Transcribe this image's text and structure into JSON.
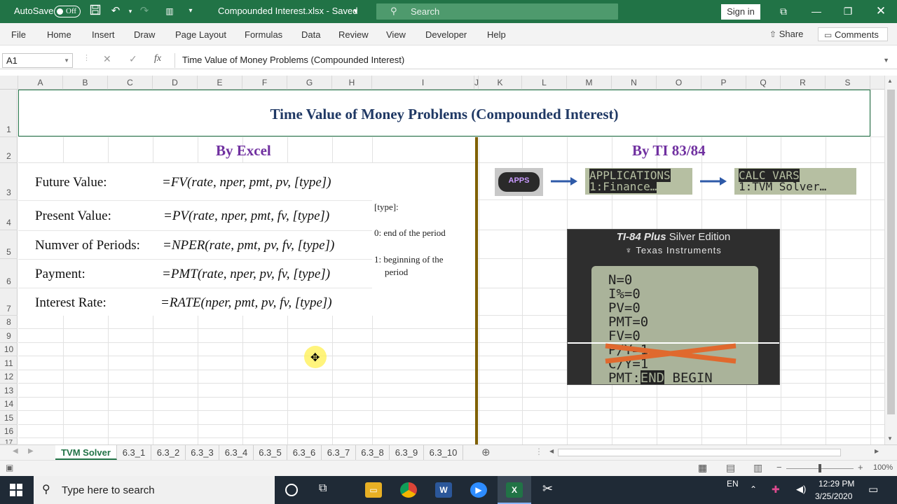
{
  "window": {
    "autosave_label": "AutoSave",
    "autosave_state": "Off",
    "doc_title": "Compounded Interest.xlsx - Saved",
    "search_placeholder": "Search",
    "signin_label": "Sign in"
  },
  "menu": {
    "items": [
      "File",
      "Home",
      "Insert",
      "Draw",
      "Page Layout",
      "Formulas",
      "Data",
      "Review",
      "View",
      "Developer",
      "Help"
    ],
    "share_label": "Share",
    "comments_label": "Comments"
  },
  "formula_bar": {
    "name_box": "A1",
    "fx_label": "fx",
    "formula": "Time Value of Money Problems (Compounded Interest)"
  },
  "grid": {
    "columns": [
      "A",
      "B",
      "C",
      "D",
      "E",
      "F",
      "G",
      "H",
      "I",
      "J",
      "K",
      "L",
      "M",
      "N",
      "O",
      "P",
      "Q",
      "R",
      "S"
    ],
    "rows": [
      "1",
      "2",
      "3",
      "4",
      "5",
      "6",
      "7",
      "8",
      "9",
      "10",
      "11",
      "12",
      "13",
      "14",
      "15",
      "16",
      "17"
    ]
  },
  "sheet": {
    "title": "Time Value of Money Problems (Compounded Interest)",
    "by_excel": "By Excel",
    "by_ti": "By TI 83/84",
    "functions": [
      {
        "label": "Future Value:",
        "formula": "=FV(rate, nper, pmt, pv, [type])"
      },
      {
        "label": "Present Value:",
        "formula": "=PV(rate, nper, pmt, fv, [type])"
      },
      {
        "label": "Numver of Periods:",
        "formula": "=NPER(rate, pmt, pv, fv, [type])"
      },
      {
        "label": "Payment:",
        "formula": "=PMT(rate, nper, pv, fv, [type])"
      },
      {
        "label": "Interest Rate:",
        "formula": "=RATE(nper, pmt, pv, fv, [type])"
      }
    ],
    "type_note": {
      "heading": "[type]:",
      "opt0": "0:  end of the period",
      "opt1a": "1:  beginning of the",
      "opt1b": "period"
    }
  },
  "ti": {
    "apps_key": "APPS",
    "screen1_line1": "APPLICATIONS",
    "screen1_line2": "1:Finance…",
    "screen2_line1": "CALC VARS",
    "screen2_line2": "1:TVM Solver…",
    "calc_brand_model": "TI-84 Plus",
    "calc_brand_edition": "Silver Edition",
    "calc_maker": "Texas Instruments",
    "calc_lines": [
      "N=0",
      "I%=0",
      "PV=0",
      "PMT=0",
      "FV=0",
      "P/Y=1",
      "C/Y=1"
    ],
    "calc_last_line_pre": "PMT:",
    "calc_last_line_inv": "END",
    "calc_last_line_post": " BEGIN"
  },
  "tabs": [
    "TVM Solver",
    "6.3_1",
    "6.3_2",
    "6.3_3",
    "6.3_4",
    "6.3_5",
    "6.3_6",
    "6.3_7",
    "6.3_8",
    "6.3_9",
    "6.3_10"
  ],
  "status": {
    "zoom": "100%"
  },
  "taskbar": {
    "search_placeholder": "Type here to search",
    "lang": "EN",
    "time": "12:29 PM",
    "date": "3/25/2020"
  },
  "colors": {
    "excel_green": "#217346",
    "title_navy": "#1f3864",
    "heading_purple": "#7030a0",
    "divider_brown": "#7f6000",
    "arrow_blue": "#2e5aa8",
    "cross_orange": "#e0692e"
  }
}
